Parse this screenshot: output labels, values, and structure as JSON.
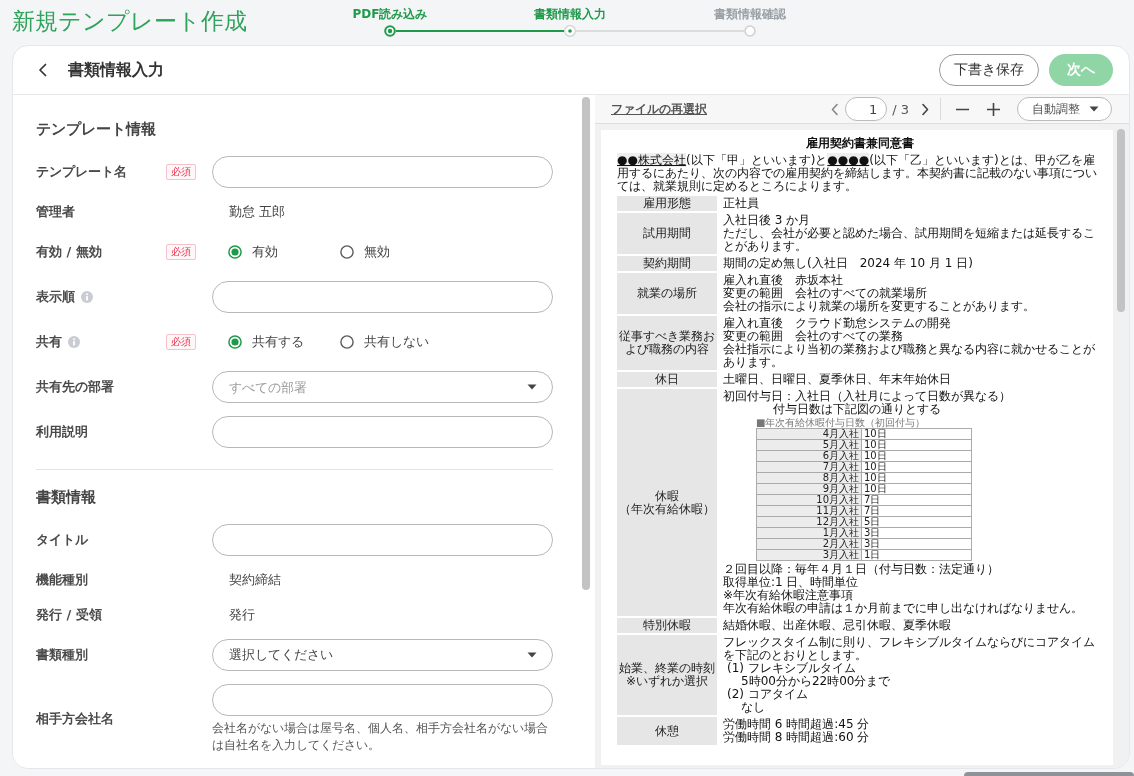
{
  "app_title": "新規テンプレート作成",
  "stepper": [
    {
      "label": "PDF読み込み",
      "completed": true,
      "selected": false
    },
    {
      "label": "書類情報入力",
      "completed": false,
      "selected": true
    },
    {
      "label": "書類情報確認",
      "completed": false,
      "selected": false
    }
  ],
  "header": {
    "title": "書類情報入力",
    "buttons": [
      {
        "label": "下書き保存",
        "kind": "secondary",
        "disabled": false
      },
      {
        "label": "次へ",
        "kind": "primary",
        "disabled": true
      }
    ]
  },
  "form": {
    "sections": [
      {
        "title": "テンプレート情報",
        "fields": [
          {
            "label": "テンプレート名",
            "kind": "text",
            "badge": "必須",
            "info": false
          },
          {
            "label": "管理者",
            "kind": "static",
            "value": "勤怠 五郎",
            "info": false
          },
          {
            "label": "有効 / 無効",
            "kind": "radio",
            "badge": "必須",
            "info": false,
            "options": [
              {
                "label": "有効",
                "selected": true
              },
              {
                "label": "無効",
                "selected": false
              }
            ]
          },
          {
            "label": "表示順",
            "kind": "text",
            "info": true
          },
          {
            "label": "共有",
            "kind": "radio",
            "badge": "必須",
            "info": true,
            "options": [
              {
                "label": "共有する",
                "selected": true
              },
              {
                "label": "共有しない",
                "selected": false
              }
            ]
          },
          {
            "label": "共有先の部署",
            "kind": "select",
            "placeholder": "すべての部署",
            "info": false
          },
          {
            "label": "利用説明",
            "kind": "text",
            "info": false
          }
        ]
      },
      {
        "title": "書類情報",
        "fields": [
          {
            "label": "タイトル",
            "kind": "text",
            "info": false
          },
          {
            "label": "機能種別",
            "kind": "static",
            "value": "契約締結",
            "info": false
          },
          {
            "label": "発行 / 受領",
            "kind": "static",
            "value": "発行",
            "info": false
          },
          {
            "label": "書類種別",
            "kind": "select",
            "value": "選択してください",
            "info": false
          },
          {
            "label": "相手方会社名",
            "kind": "text",
            "help": "会社名がない場合は屋号名、個人名、相手方会社名がない場合は自社名を入力してください。",
            "info": false
          }
        ]
      }
    ]
  },
  "viewer": {
    "reselect_link": "ファイルの再選択",
    "page": "1",
    "page_count": "/ 3",
    "zoom": "自動調整",
    "document": {
      "title": "雇用契約書兼同意書",
      "intro": [
        {
          "text": "●●株式会社",
          "underlined": true
        },
        {
          "text": "(以下「甲」といいます)と",
          "underlined": false
        },
        {
          "text": "●●●●",
          "underlined": true
        },
        {
          "text": "(以下「乙」といいます)とは、甲が乙を雇用するにあたり、次の内容での雇用契約を締結します。本契約書に記載のない事項については、就業規則に定めるところによります。",
          "underlined": false
        }
      ],
      "rows": [
        {
          "label": [
            "雇用形態"
          ],
          "lines": [
            {
              "kind": "text",
              "text": "正社員"
            }
          ]
        },
        {
          "label": [
            "試用期間"
          ],
          "lines": [
            {
              "kind": "text",
              "text": "入社日後 3 か月"
            },
            {
              "kind": "text",
              "text": "ただし、会社が必要と認めた場合、試用期間を短縮または延長することがあります。"
            }
          ]
        },
        {
          "label": [
            "契約期間"
          ],
          "lines": [
            {
              "kind": "text",
              "text": "期間の定め無し(入社日　2024 年 10 月 1 日)"
            }
          ]
        },
        {
          "label": [
            "就業の場所"
          ],
          "lines": [
            {
              "kind": "text",
              "text": "雇入れ直後　赤坂本社"
            },
            {
              "kind": "text",
              "text": "変更の範囲　会社のすべての就業場所"
            },
            {
              "kind": "text",
              "text": "会社の指示により就業の場所を変更することがあります。"
            }
          ]
        },
        {
          "label": [
            "従事すべき業務お",
            "よび職務の内容"
          ],
          "lines": [
            {
              "kind": "text",
              "text": "雇入れ直後　クラウド勤怠システムの開発"
            },
            {
              "kind": "text",
              "text": "変更の範囲　会社のすべての業務"
            },
            {
              "kind": "text",
              "text": "会社指示により当初の業務および職務と異なる内容に就かせることがあります。"
            }
          ]
        },
        {
          "label": [
            "休日"
          ],
          "lines": [
            {
              "kind": "text",
              "text": "土曜日、日曜日、夏季休日、年末年始休日"
            }
          ]
        },
        {
          "label": [
            "休暇",
            "（年次有給休暇）"
          ],
          "lines": [
            {
              "kind": "text",
              "text": "初回付与日：入社日（入社月によって日数が異なる）"
            },
            {
              "kind": "indent",
              "text": "付与日数は下記図の通りとする"
            },
            {
              "kind": "table",
              "caption": "■年次有給休暇付与日数（初回付与）",
              "rows": [
                {
                  "month": "4月入社",
                  "days": "10日"
                },
                {
                  "month": "5月入社",
                  "days": "10日"
                },
                {
                  "month": "6月入社",
                  "days": "10日"
                },
                {
                  "month": "7月入社",
                  "days": "10日"
                },
                {
                  "month": "8月入社",
                  "days": "10日"
                },
                {
                  "month": "9月入社",
                  "days": "10日"
                },
                {
                  "month": "10月入社",
                  "days": "7日"
                },
                {
                  "month": "11月入社",
                  "days": "7日"
                },
                {
                  "month": "12月入社",
                  "days": "5日"
                },
                {
                  "month": "1月入社",
                  "days": "3日"
                },
                {
                  "month": "2月入社",
                  "days": "3日"
                },
                {
                  "month": "3月入社",
                  "days": "1日"
                }
              ]
            },
            {
              "kind": "text",
              "text": "２回目以降：毎年４月１日（付与日数：法定通り）"
            },
            {
              "kind": "text",
              "text": "取得単位:1 日、時間単位"
            },
            {
              "kind": "text",
              "text": "※年次有給休暇注意事項"
            },
            {
              "kind": "text",
              "text": "年次有給休暇の申請は１か月前までに申し出なければなりません。"
            }
          ]
        },
        {
          "label": [
            "特別休暇"
          ],
          "lines": [
            {
              "kind": "text",
              "text": "結婚休暇、出産休暇、忌引休暇、夏季休暇"
            }
          ]
        },
        {
          "label": [
            "始業、終業の時刻",
            "※いずれか選択"
          ],
          "lines": [
            {
              "kind": "text",
              "text": "フレックスタイム制に則り、フレキシブルタイムならびにコアタイムを下記のとおりとします。"
            },
            {
              "kind": "item",
              "text": "(1) フレキシブルタイム"
            },
            {
              "kind": "sub",
              "text": "5時00分から22時00分まで"
            },
            {
              "kind": "item",
              "text": "(2) コアタイム"
            },
            {
              "kind": "sub",
              "text": "なし"
            }
          ]
        },
        {
          "label": [
            "休憩"
          ],
          "lines": [
            {
              "kind": "text",
              "text": "労働時間 6 時間超過:45 分"
            },
            {
              "kind": "text",
              "text": "労働時間 8 時間超過:60 分"
            }
          ]
        }
      ]
    }
  }
}
